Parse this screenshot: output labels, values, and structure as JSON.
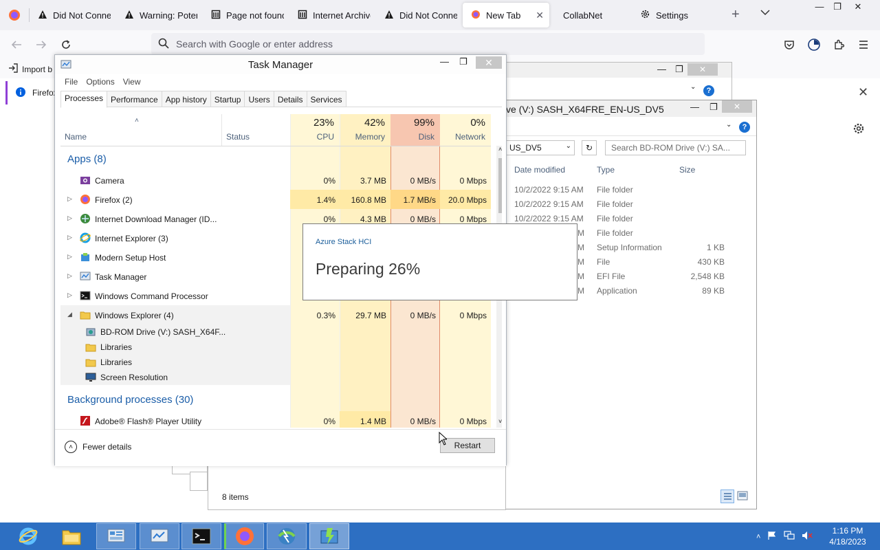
{
  "browser": {
    "tabs": [
      {
        "label": "Did Not Connect:",
        "icon": "warning-icon"
      },
      {
        "label": "Warning: Potential",
        "icon": "warning-icon"
      },
      {
        "label": "Page not found",
        "icon": "page-icon"
      },
      {
        "label": "Internet Archive",
        "icon": "archive-icon"
      },
      {
        "label": "Did Not Connect:",
        "icon": "warning-icon"
      },
      {
        "label": "New Tab",
        "icon": "firefox-icon",
        "active": true
      },
      {
        "label": "CollabNet",
        "icon": ""
      },
      {
        "label": "Settings",
        "icon": "gear-icon"
      }
    ],
    "url_placeholder": "Search with Google or enter address",
    "import_bookmarks": "Import b",
    "notification": "Firefox"
  },
  "explorer": {
    "title": "ve (V:) SASH_X64FRE_EN-US_DV5",
    "address": "US_DV5",
    "search_placeholder": "Search BD-ROM Drive (V:) SA...",
    "columns": {
      "date": "Date modified",
      "type": "Type",
      "size": "Size"
    },
    "rows": [
      {
        "date": "10/2/2022 9:15 AM",
        "type": "File folder",
        "size": ""
      },
      {
        "date": "10/2/2022 9:15 AM",
        "type": "File folder",
        "size": ""
      },
      {
        "date": "10/2/2022 9:15 AM",
        "type": "File folder",
        "size": ""
      },
      {
        "date": "M",
        "type": "File folder",
        "size": ""
      },
      {
        "date": "M",
        "type": "Setup Information",
        "size": "1 KB"
      },
      {
        "date": "M",
        "type": "File",
        "size": "430 KB"
      },
      {
        "date": "M",
        "type": "EFI File",
        "size": "2,548 KB"
      },
      {
        "date": "M",
        "type": "Application",
        "size": "89 KB"
      }
    ],
    "status": "8 items"
  },
  "task_manager": {
    "title": "Task Manager",
    "menu": [
      "File",
      "Options",
      "View"
    ],
    "tabs": [
      "Processes",
      "Performance",
      "App history",
      "Startup",
      "Users",
      "Details",
      "Services"
    ],
    "columns": {
      "name": "Name",
      "status": "Status",
      "cpu": {
        "pct": "23%",
        "label": "CPU"
      },
      "memory": {
        "pct": "42%",
        "label": "Memory"
      },
      "disk": {
        "pct": "99%",
        "label": "Disk"
      },
      "network": {
        "pct": "0%",
        "label": "Network"
      }
    },
    "apps_header": "Apps (8)",
    "apps": [
      {
        "name": "Camera",
        "cpu": "0%",
        "memory": "3.7 MB",
        "disk": "0 MB/s",
        "network": "0 Mbps",
        "icon": "camera-icon",
        "expander": ""
      },
      {
        "name": "Firefox (2)",
        "cpu": "1.4%",
        "memory": "160.8 MB",
        "disk": "1.7 MB/s",
        "network": "20.0 Mbps",
        "icon": "firefox-icon",
        "expander": "▷"
      },
      {
        "name": "Internet Download Manager (ID...",
        "cpu": "0%",
        "memory": "4.3 MB",
        "disk": "0 MB/s",
        "network": "0 Mbps",
        "icon": "idm-icon",
        "expander": "▷"
      },
      {
        "name": "Internet Explorer (3)",
        "cpu": "",
        "memory": "",
        "disk": "",
        "network": "",
        "icon": "ie-icon",
        "expander": "▷"
      },
      {
        "name": "Modern Setup Host",
        "cpu": "",
        "memory": "",
        "disk": "",
        "network": "",
        "icon": "setup-icon",
        "expander": "▷"
      },
      {
        "name": "Task Manager",
        "cpu": "",
        "memory": "",
        "disk": "",
        "network": "",
        "icon": "taskmanager-icon",
        "expander": "▷"
      },
      {
        "name": "Windows Command Processor",
        "cpu": "",
        "memory": "",
        "disk": "",
        "network": "",
        "icon": "cmd-icon",
        "expander": "▷"
      },
      {
        "name": "Windows Explorer (4)",
        "cpu": "0.3%",
        "memory": "29.7 MB",
        "disk": "0 MB/s",
        "network": "0 Mbps",
        "icon": "folder-icon",
        "expander": "◢"
      }
    ],
    "explorer_children": [
      {
        "name": "BD-ROM Drive (V:) SASH_X64F...",
        "icon": "drive-icon"
      },
      {
        "name": "Libraries",
        "icon": "folder-icon"
      },
      {
        "name": "Libraries",
        "icon": "folder-icon"
      },
      {
        "name": "Screen Resolution",
        "icon": "monitor-icon"
      }
    ],
    "bg_header": "Background processes (30)",
    "bg_processes": [
      {
        "name": "Adobe® Flash® Player Utility",
        "cpu": "0%",
        "memory": "1.4 MB",
        "disk": "0 MB/s",
        "network": "0 Mbps",
        "icon": "flash-icon"
      }
    ],
    "fewer_details": "Fewer details",
    "restart": "Restart",
    "colors": {
      "disk_header": "#f7c6b0",
      "disk_col": "#fbe6d1",
      "cell_warm": "#fff4c4",
      "cell_hot": "#ffd887"
    }
  },
  "azure_popup": {
    "product": "Azure Stack HCI",
    "status": "Preparing 26%"
  },
  "taskbar": {
    "time": "1:16 PM",
    "date": "4/18/2023",
    "apps": [
      "ie-icon",
      "file-explorer-icon",
      "server-manager-icon",
      "settings-icon",
      "cmd-icon",
      "firefox-icon",
      "idm-icon",
      "setup-icon"
    ]
  }
}
